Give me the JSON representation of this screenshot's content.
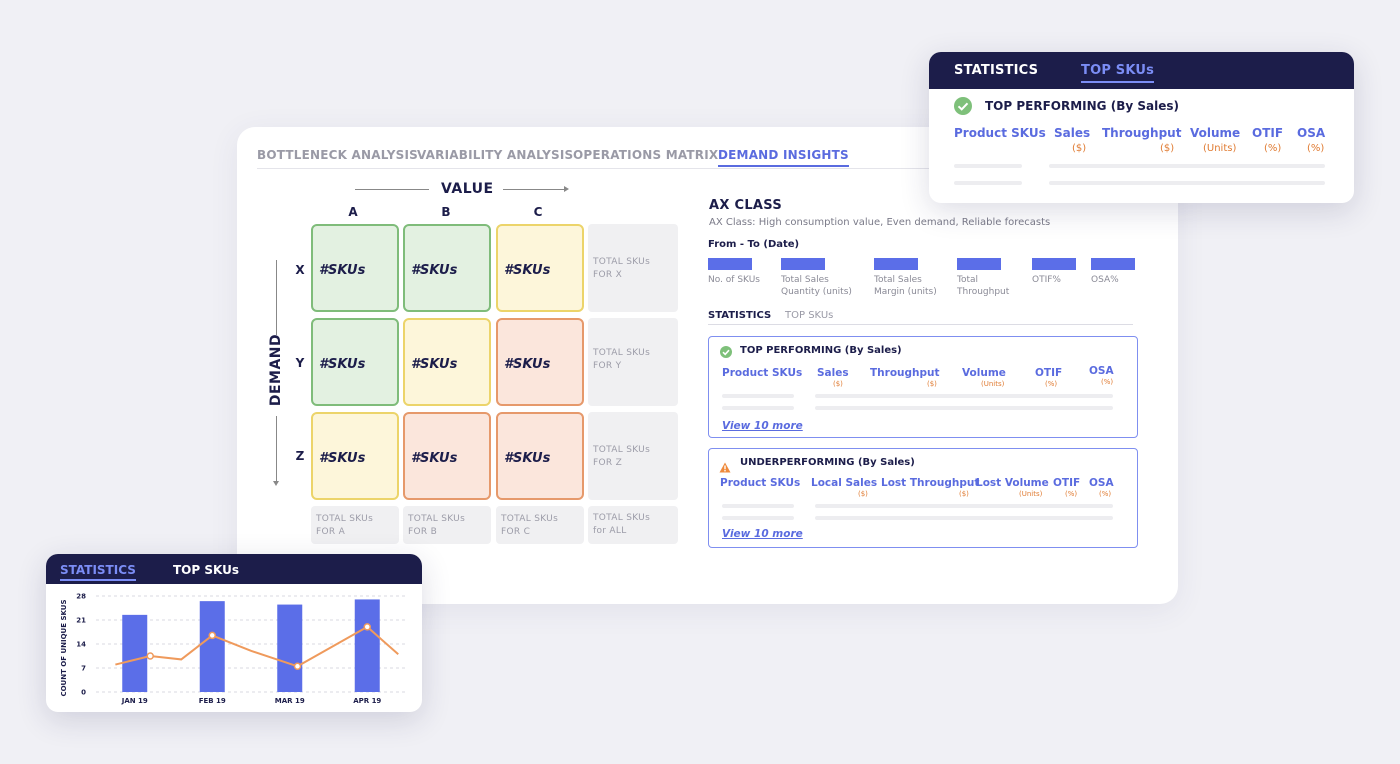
{
  "main_tabs": [
    {
      "label": "BOTTLENECK ANALYSIS"
    },
    {
      "label": "VARIABILITY ANALYSIS"
    },
    {
      "label": "OPERATIONS MATRIX"
    },
    {
      "label": "DEMAND INSIGHTS",
      "active": true
    }
  ],
  "matrix": {
    "value_label": "VALUE",
    "demand_label": "DEMAND",
    "columns": [
      "A",
      "B",
      "C"
    ],
    "rows": [
      "X",
      "Y",
      "Z"
    ],
    "cell_text": "#SKUs",
    "row_totals": [
      "TOTAL SKUs FOR X",
      "TOTAL SKUs FOR Y",
      "TOTAL SKUs FOR Z"
    ],
    "col_totals": [
      "TOTAL SKUs FOR A",
      "TOTAL SKUs FOR B",
      "TOTAL SKUs FOR C",
      "TOTAL SKUs for ALL"
    ]
  },
  "ax_panel": {
    "title": "AX CLASS",
    "subtitle": "AX Class: High consumption value, Even demand, Reliable forecasts",
    "date_label": "From - To (Date)",
    "metrics": [
      {
        "label1": "No. of SKUs",
        "label2": ""
      },
      {
        "label1": "Total Sales",
        "label2": "Quantity (units)"
      },
      {
        "label1": "Total Sales",
        "label2": "Margin (units)"
      },
      {
        "label1": "Total",
        "label2": "Throughput"
      },
      {
        "label1": "OTIF%",
        "label2": ""
      },
      {
        "label1": "OSA%",
        "label2": ""
      }
    ],
    "sub_tabs": [
      {
        "label": "STATISTICS",
        "active": true
      },
      {
        "label": "TOP SKUs"
      }
    ],
    "top_performing": {
      "title": "TOP PERFORMING (By Sales)",
      "columns": [
        {
          "label": "Product SKUs",
          "unit": ""
        },
        {
          "label": "Sales",
          "unit": "($)"
        },
        {
          "label": "Throughput",
          "unit": "($)"
        },
        {
          "label": "Volume",
          "unit": "(Units)"
        },
        {
          "label": "OTIF",
          "unit": "(%)"
        },
        {
          "label": "OSA",
          "unit": "(%)"
        }
      ],
      "view_more": "View 10 more"
    },
    "underperforming": {
      "title": "UNDERPERFORMING (By Sales)",
      "columns": [
        {
          "label": "Product SKUs",
          "unit": ""
        },
        {
          "label": "Local Sales",
          "unit": "($)"
        },
        {
          "label": "Lost Throughput",
          "unit": "($)"
        },
        {
          "label": "Lost Volume",
          "unit": "(Units)"
        },
        {
          "label": "OTIF",
          "unit": "(%)"
        },
        {
          "label": "OSA",
          "unit": "(%)"
        }
      ],
      "view_more": "View 10 more"
    }
  },
  "top_right_card": {
    "tabs": [
      {
        "label": "STATISTICS"
      },
      {
        "label": "TOP SKUs",
        "active": true
      }
    ],
    "title": "TOP PERFORMING (By Sales)",
    "columns": [
      {
        "label": "Product SKUs",
        "unit": ""
      },
      {
        "label": "Sales",
        "unit": "($)"
      },
      {
        "label": "Throughput",
        "unit": "($)"
      },
      {
        "label": "Volume",
        "unit": "(Units)"
      },
      {
        "label": "OTIF",
        "unit": "(%)"
      },
      {
        "label": "OSA",
        "unit": "(%)"
      }
    ]
  },
  "bottom_left_card": {
    "tabs": [
      {
        "label": "STATISTICS",
        "active": true
      },
      {
        "label": "TOP SKUs"
      }
    ],
    "ylabel": "COUNT OF UNIQUE SKUS"
  },
  "chart_data": {
    "type": "bar",
    "categories": [
      "JAN 19",
      "FEB 19",
      "MAR 19",
      "APR 19"
    ],
    "ylabel": "COUNT OF UNIQUE SKUS",
    "ylim": [
      0,
      28
    ],
    "yticks": [
      0,
      7,
      14,
      21,
      28
    ],
    "grid": true,
    "series": [
      {
        "type": "bar",
        "values": [
          22.5,
          26.5,
          25.5,
          27
        ]
      },
      {
        "type": "line",
        "x": [
          -0.25,
          0.2,
          0.6,
          1.0,
          1.5,
          2.1,
          3.0,
          3.4
        ],
        "values": [
          8,
          10.5,
          9.5,
          16.5,
          12,
          7.5,
          19,
          11
        ]
      }
    ],
    "colors": {
      "bar": "#5b6ee8",
      "line": "#ef9a5c"
    }
  }
}
